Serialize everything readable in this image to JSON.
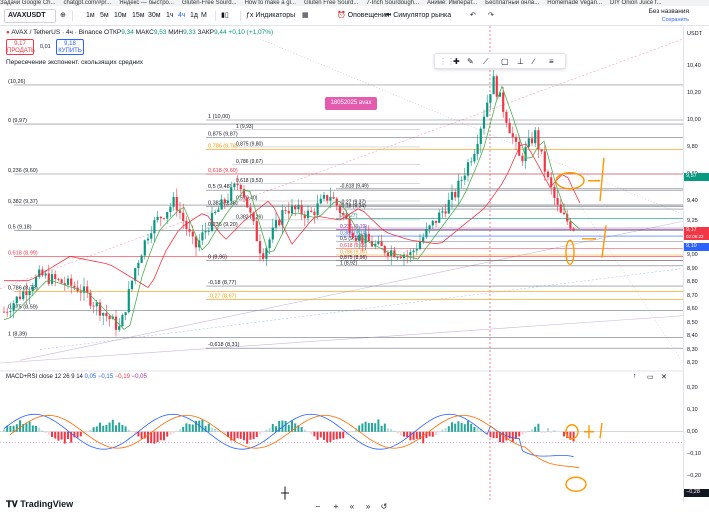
{
  "browser": {
    "bookmarks": [
      "Задачи Google Ch...",
      "chatgpt.com/#pr...",
      "Яндекс — быстро...",
      "Gluten-Free Sourd...",
      "How to make a gl...",
      "Gluten Free Sourd...",
      "7-Inch Sourdough...",
      "Аниме: Императ...",
      "Бесплатный онла...",
      "Homemade Vegan...",
      "DIY Onion Juice f..."
    ]
  },
  "toolbar": {
    "symbol": "AVAXUSDT",
    "add_icon": "plus-circle-icon",
    "timeframes": [
      "1м",
      "5м",
      "10м",
      "15м",
      "30м",
      "1ч",
      "4ч",
      "1д",
      "М"
    ],
    "active_timeframe": "4ч",
    "indicators_label": "Индикаторы",
    "alerts_label": "Оповещения",
    "replay_label": "Симулятор рынка",
    "save_label": "Без названия",
    "save_sub": "Сохранить"
  },
  "legend": {
    "title": "AVAX / TetherUS · 4ч · Binance",
    "o_label": "ОТКР",
    "o_value": "9,34",
    "h_label": "МАКС",
    "h_value": "9,53",
    "l_label": "МИН",
    "l_value": "9,33",
    "c_label": "ЗАКР",
    "c_value": "9,44",
    "change": "+0,10 (+1,07%)",
    "sell_price": "9,17",
    "sell_label": "ПРОДАТЬ",
    "spread": "0,01",
    "buy_price": "9,18",
    "buy_label": "КУПИТЬ",
    "ema_label": "Пересечение экспонент. скользящих средних"
  },
  "date_tag": "18052025 avax",
  "fib_left": [
    {
      "label": "(10,26)",
      "price": 10.26
    },
    {
      "label": "0 (9,97)",
      "price": 9.97
    },
    {
      "label": "0,236 (9,60)",
      "price": 9.6
    },
    {
      "label": "0,382 (9,37)",
      "price": 9.37
    },
    {
      "label": "0,5 (9,18)",
      "price": 9.18
    },
    {
      "label": "0,618 (8,99)",
      "price": 8.99
    },
    {
      "label": "0,786 (8,73)",
      "price": 8.73
    },
    {
      "label": "0,875 (8,59)",
      "price": 8.59
    },
    {
      "label": "1 (8,39)",
      "price": 8.39
    }
  ],
  "fib_mid": [
    {
      "label": "1 (10,00)",
      "price": 10.0
    },
    {
      "label": "0,875 (9,87)",
      "price": 9.87
    },
    {
      "label": "0,786 (9,78)",
      "price": 9.78
    },
    {
      "label": "0,618 (9,60)",
      "price": 9.6
    },
    {
      "label": "0,5 (9,48)",
      "price": 9.48
    },
    {
      "label": "0,382 (9,36)",
      "price": 9.36
    },
    {
      "label": "0,236 (9,20)",
      "price": 9.2
    },
    {
      "label": "0 (8,96)",
      "price": 8.96
    },
    {
      "label": "-0,18 (8,77)",
      "price": 8.77
    },
    {
      "label": "-0,27 (8,67)",
      "price": 8.67
    },
    {
      "label": "-0,618 (8,31)",
      "price": 8.31
    }
  ],
  "fib_inner": [
    {
      "label": "1 (9,93)",
      "price": 9.93
    },
    {
      "label": "0,875 (9,80)",
      "price": 9.8
    },
    {
      "label": "0,786 (9,67)",
      "price": 9.67
    },
    {
      "label": "0,618 (9,53)",
      "price": 9.53
    },
    {
      "label": "0,5 (9,40)",
      "price": 9.4
    },
    {
      "label": "0,382 (9,26)",
      "price": 9.26
    }
  ],
  "fib_right": [
    {
      "label": "-0,618 (9,49)",
      "price": 9.49
    },
    {
      "label": "-0,27 (9,37)",
      "price": 9.37
    },
    {
      "label": "-0,18 (9,34)",
      "price": 9.34
    },
    {
      "label": "0 (9,27)",
      "price": 9.27
    },
    {
      "label": "0,236 (9,19)",
      "price": 9.19
    },
    {
      "label": "0,382 (9,14)",
      "price": 9.14
    },
    {
      "label": "0,5 (9,10)",
      "price": 9.1
    },
    {
      "label": "0,618 (9,05)",
      "price": 9.05
    },
    {
      "label": "0,786 (9,00)",
      "price": 9.0
    },
    {
      "label": "0,875 (8,96)",
      "price": 8.96
    },
    {
      "label": "1 (8,92)",
      "price": 8.92
    }
  ],
  "price_scale": {
    "currency": "USDT",
    "ticks": [
      "10,40",
      "10,20",
      "10,00",
      "9,80",
      "9,60",
      "9,40",
      "9,25",
      "9,00",
      "8,90",
      "8,80",
      "8,70",
      "8,60",
      "8,50",
      "8,40",
      "8,30",
      "8,20"
    ],
    "tick_values": [
      10.4,
      10.2,
      10.0,
      9.8,
      9.6,
      9.4,
      9.25,
      9.0,
      8.9,
      8.8,
      8.7,
      8.6,
      8.5,
      8.4,
      8.3,
      8.2
    ],
    "tag_green": "9,57",
    "tag_green_value": 9.57,
    "tag_red": "9,17",
    "tag_red_sub": "02:06:22",
    "tag_red_value": 9.17,
    "tag_blue": "9,10",
    "tag_blue_value": 9.1,
    "colors": {
      "green": "#089981",
      "red": "#f23645",
      "blue": "#2962ff"
    }
  },
  "indicator": {
    "title": "MACD+RSI close 12 26 9 14",
    "v1": "0,05",
    "v2": "−0,15",
    "v3": "−0,19",
    "v4": "−0,05",
    "ticks": [
      "0,20",
      "0,10",
      "0,00",
      "−0,10",
      "−0,20",
      "−0,28"
    ],
    "tick_values": [
      0.2,
      0.1,
      0.0,
      -0.1,
      -0.2,
      -0.28
    ],
    "tag": "−0,28",
    "tag_value": -0.28
  },
  "annotations": [
    "-1",
    "0",
    "-1",
    "0",
    "+1"
  ],
  "bottom": {
    "brand": "TradingView",
    "zoom_out": "−",
    "zoom_in": "+",
    "scroll_left": "«",
    "scroll_right": "»",
    "reset": "↺"
  }
}
